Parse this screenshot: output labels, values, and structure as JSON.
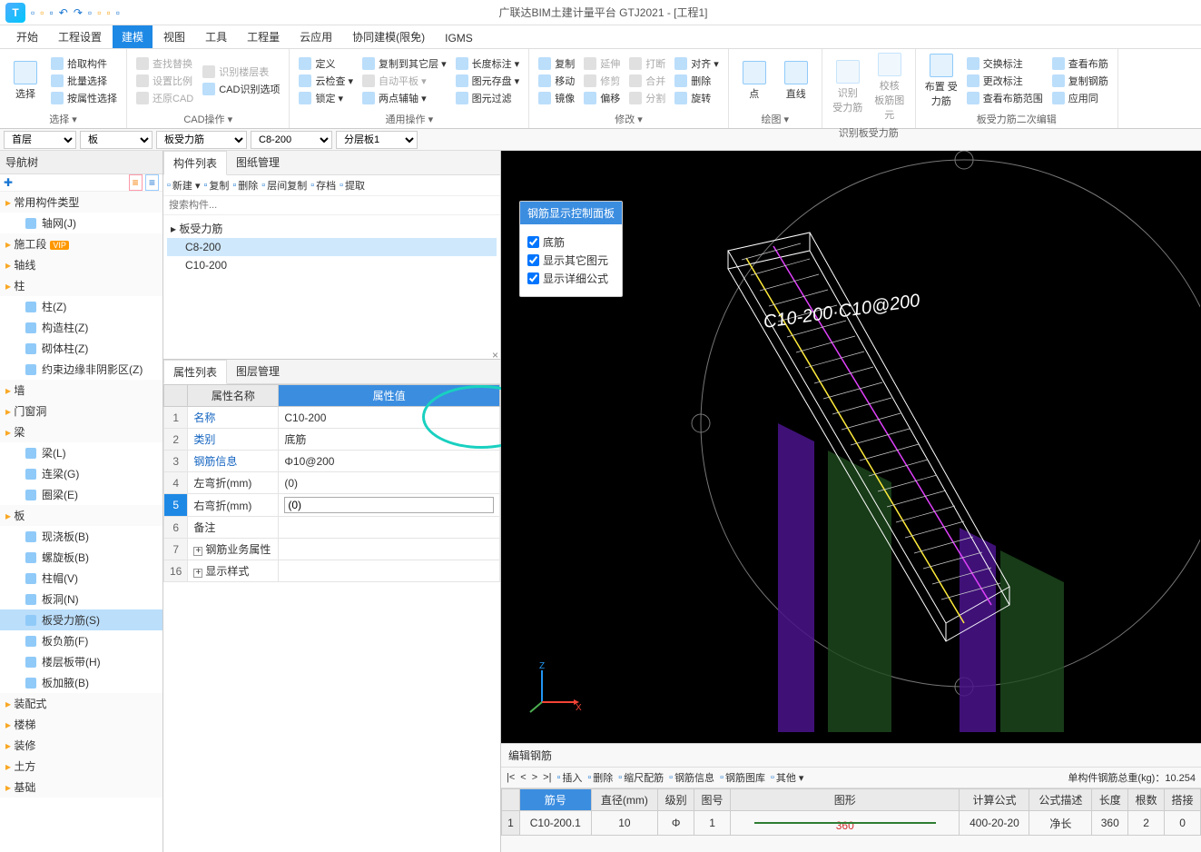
{
  "app": {
    "title": "广联达BIM土建计量平台 GTJ2021 - [工程1]"
  },
  "menu": {
    "tabs": [
      "开始",
      "工程设置",
      "建模",
      "视图",
      "工具",
      "工程量",
      "云应用",
      "协同建模(限免)",
      "IGMS"
    ],
    "active": 2
  },
  "ribbon": {
    "groups": [
      {
        "label": "选择 ▾",
        "big": {
          "label": "选择"
        },
        "cols": [
          [
            {
              "t": "拾取构件"
            },
            {
              "t": "批量选择"
            },
            {
              "t": "按属性选择"
            }
          ]
        ]
      },
      {
        "label": "CAD操作 ▾",
        "cols": [
          [
            {
              "t": "查找替换",
              "dim": true
            },
            {
              "t": "设置比例",
              "dim": true
            },
            {
              "t": "还原CAD",
              "dim": true
            }
          ],
          [
            {
              "t": "识别楼层表",
              "dim": true
            },
            {
              "t": "CAD识别选项"
            }
          ]
        ]
      },
      {
        "label": "通用操作 ▾",
        "cols": [
          [
            {
              "t": "定义"
            },
            {
              "t": "云检查 ▾"
            },
            {
              "t": "锁定 ▾"
            }
          ],
          [
            {
              "t": "复制到其它层 ▾"
            },
            {
              "t": "自动平板 ▾",
              "dim": true
            },
            {
              "t": "两点辅轴 ▾"
            }
          ],
          [
            {
              "t": "长度标注 ▾"
            },
            {
              "t": "图元存盘 ▾"
            },
            {
              "t": "图元过滤"
            }
          ]
        ]
      },
      {
        "label": "修改 ▾",
        "cols": [
          [
            {
              "t": "复制"
            },
            {
              "t": "移动"
            },
            {
              "t": "镜像"
            }
          ],
          [
            {
              "t": "延伸",
              "dim": true
            },
            {
              "t": "修剪",
              "dim": true
            },
            {
              "t": "偏移"
            }
          ],
          [
            {
              "t": "打断",
              "dim": true
            },
            {
              "t": "合并",
              "dim": true
            },
            {
              "t": "分割",
              "dim": true
            }
          ],
          [
            {
              "t": "对齐 ▾"
            },
            {
              "t": "删除"
            },
            {
              "t": "旋转"
            }
          ]
        ]
      },
      {
        "label": "绘图 ▾",
        "bigs": [
          {
            "label": "点"
          },
          {
            "label": "直线"
          }
        ]
      },
      {
        "label": "识别板受力筋",
        "bigs": [
          {
            "label": "识别\n受力筋"
          },
          {
            "label": "校核\n板筋图元"
          }
        ],
        "dim": true
      },
      {
        "label": "板受力筋二次编辑",
        "big": {
          "label": "布置\n受力筋"
        },
        "cols": [
          [
            {
              "t": "交换标注"
            },
            {
              "t": "更改标注"
            },
            {
              "t": "查看布筋范围"
            }
          ],
          [
            {
              "t": "查看布筋"
            },
            {
              "t": "复制钢筋"
            },
            {
              "t": "应用同"
            }
          ]
        ]
      }
    ]
  },
  "contextBar": {
    "floor": "首层",
    "cat": "板",
    "sub": "板受力筋",
    "member": "C8-200",
    "layer": "分层板1"
  },
  "nav": {
    "title": "导航树",
    "sections": [
      {
        "label": "常用构件类型",
        "items": [
          {
            "t": "轴网(J)"
          }
        ]
      },
      {
        "label": "施工段",
        "vip": true
      },
      {
        "label": "轴线"
      },
      {
        "label": "柱",
        "items": [
          {
            "t": "柱(Z)"
          },
          {
            "t": "构造柱(Z)"
          },
          {
            "t": "砌体柱(Z)"
          },
          {
            "t": "约束边缘非阴影区(Z)"
          }
        ]
      },
      {
        "label": "墙"
      },
      {
        "label": "门窗洞"
      },
      {
        "label": "梁",
        "items": [
          {
            "t": "梁(L)"
          },
          {
            "t": "连梁(G)"
          },
          {
            "t": "圈梁(E)"
          }
        ]
      },
      {
        "label": "板",
        "items": [
          {
            "t": "现浇板(B)"
          },
          {
            "t": "螺旋板(B)"
          },
          {
            "t": "柱帽(V)"
          },
          {
            "t": "板洞(N)"
          },
          {
            "t": "板受力筋(S)",
            "sel": true
          },
          {
            "t": "板负筋(F)"
          },
          {
            "t": "楼层板带(H)"
          },
          {
            "t": "板加腋(B)"
          }
        ]
      },
      {
        "label": "装配式"
      },
      {
        "label": "楼梯"
      },
      {
        "label": "装修"
      },
      {
        "label": "土方"
      },
      {
        "label": "基础"
      }
    ]
  },
  "compList": {
    "tabs": [
      "构件列表",
      "图纸管理"
    ],
    "toolbar": [
      "新建 ▾",
      "复制",
      "删除",
      "层间复制",
      "存档",
      "提取"
    ],
    "searchPlaceholder": "搜索构件...",
    "root": "板受力筋",
    "items": [
      {
        "t": "C8-200",
        "sel": true
      },
      {
        "t": "C10-200"
      }
    ]
  },
  "propPanel": {
    "tabs": [
      "属性列表",
      "图层管理"
    ],
    "headers": [
      "属性名称",
      "属性值"
    ],
    "rows": [
      {
        "n": "1",
        "name": "名称",
        "val": "C10-200",
        "blue": true
      },
      {
        "n": "2",
        "name": "类别",
        "val": "底筋",
        "blue": true
      },
      {
        "n": "3",
        "name": "钢筋信息",
        "val": "Φ10@200",
        "blue": true
      },
      {
        "n": "4",
        "name": "左弯折(mm)",
        "val": "(0)"
      },
      {
        "n": "5",
        "name": "右弯折(mm)",
        "val": "(0)",
        "sel": true,
        "input": true
      },
      {
        "n": "6",
        "name": "备注"
      },
      {
        "n": "7",
        "name": "钢筋业务属性",
        "exp": true
      },
      {
        "n": "16",
        "name": "显示样式",
        "exp": true
      }
    ]
  },
  "overlay": {
    "title": "钢筋显示控制面板",
    "checks": [
      {
        "label": "底筋",
        "checked": true
      },
      {
        "label": "显示其它图元",
        "checked": true
      },
      {
        "label": "显示详细公式",
        "checked": true
      }
    ]
  },
  "rebarEdit": {
    "title": "编辑钢筋",
    "toolbar": [
      "|<",
      "<",
      ">",
      ">|",
      "插入",
      "删除",
      "缩尺配筋",
      "钢筋信息",
      "钢筋图库",
      "其他 ▾"
    ],
    "summary": "单构件钢筋总重(kg)：10.254",
    "headers": [
      "筋号",
      "直径(mm)",
      "级别",
      "图号",
      "图形",
      "计算公式",
      "公式描述",
      "长度",
      "根数",
      "搭接"
    ],
    "row": {
      "num": "1",
      "id": "C10-200.1",
      "dia": "10",
      "grade": "Φ",
      "fig": "1",
      "shape": "360",
      "formula": "400-20-20",
      "desc": "净长",
      "len": "360",
      "cnt": "2",
      "lap": "0"
    }
  },
  "viewport": {
    "label3d": "C10-200·C10@200"
  }
}
